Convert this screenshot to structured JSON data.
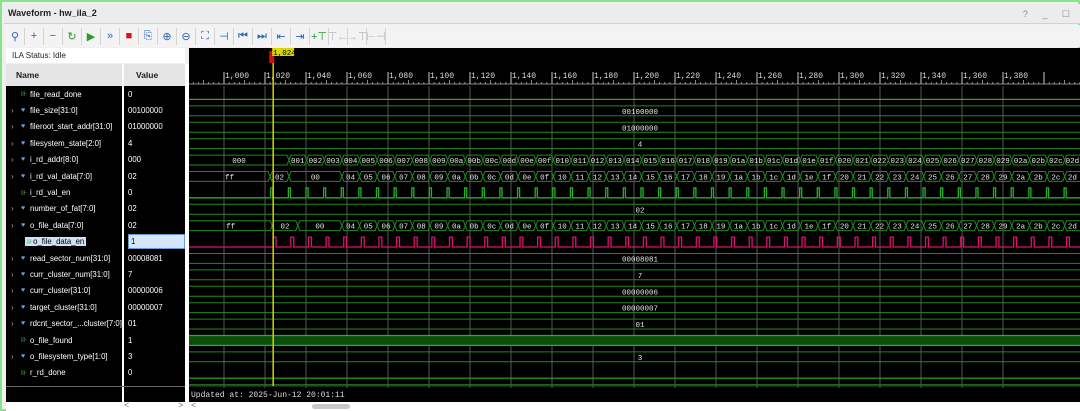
{
  "window": {
    "title": "Waveform - hw_ila_2",
    "controls": "? _ ☐"
  },
  "toolbar": [
    {
      "name": "search",
      "glyph": "⚲"
    },
    {
      "name": "add",
      "glyph": "+"
    },
    {
      "name": "remove",
      "glyph": "−"
    },
    {
      "name": "run-trigger-immediate",
      "glyph": "↻"
    },
    {
      "name": "run-trigger",
      "glyph": "▶"
    },
    {
      "name": "run-continuous",
      "glyph": "»"
    },
    {
      "name": "stop",
      "glyph": "■"
    },
    {
      "name": "export",
      "glyph": "⎘"
    },
    {
      "name": "zoom-in",
      "glyph": "⊕"
    },
    {
      "name": "zoom-out",
      "glyph": "⊖"
    },
    {
      "name": "zoom-fit",
      "glyph": "⛶"
    },
    {
      "name": "goto-cursor",
      "glyph": "⊣"
    },
    {
      "name": "go-to-start",
      "glyph": "⏮"
    },
    {
      "name": "go-to-end",
      "glyph": "⏭"
    },
    {
      "name": "previous-transition",
      "glyph": "⇤"
    },
    {
      "name": "next-transition",
      "glyph": "⇥"
    },
    {
      "name": "add-marker",
      "glyph": "+⊤"
    },
    {
      "name": "previous-marker",
      "glyph": "⊤←",
      "disabled": true
    },
    {
      "name": "next-marker",
      "glyph": "→⊤",
      "disabled": true
    },
    {
      "name": "swap-cursors",
      "glyph": "⊢⊣",
      "disabled": true
    }
  ],
  "status": "ILA Status:  Idle",
  "columns": {
    "name": "Name",
    "value": "Value"
  },
  "colors": {
    "bus": "#1f8a1f",
    "bit": "#23b223",
    "selected": "#e0106e",
    "cursor": "#c8c800",
    "found_fill": "#0b4d0b"
  },
  "timeline": {
    "ticks": [
      "1,000",
      "1,020",
      "1,040",
      "1,060",
      "1,080",
      "1,100",
      "1,120",
      "1,140",
      "1,160",
      "1,180",
      "1,200",
      "1,220",
      "1,240",
      "1,260",
      "1,280",
      "1,300",
      "1,320",
      "1,340",
      "1,360",
      "1,380"
    ],
    "start": 1000,
    "step": 20,
    "cursor": 1024,
    "cursor_label": "1,024"
  },
  "signals": [
    {
      "name": "file_read_done",
      "value": "0",
      "kind": "bit",
      "level": 0
    },
    {
      "name": "file_size[31:0]",
      "value": "00100000",
      "kind": "bus",
      "const": "00100000"
    },
    {
      "name": "fileroot_start_addr[31:0]",
      "value": "01000000",
      "kind": "bus",
      "const": "01000000"
    },
    {
      "name": "filesystem_state[2:0]",
      "value": "4",
      "kind": "bus",
      "const": "4"
    },
    {
      "name": "i_rd_addr[8:0]",
      "value": "000",
      "kind": "bus",
      "pre": [
        {
          "v": "000",
          "until": 1031.7
        }
      ],
      "start": 1031.7,
      "period": 8.6,
      "values": [
        "001",
        "002",
        "003",
        "004",
        "005",
        "006",
        "007",
        "008",
        "009",
        "00a",
        "00b",
        "00c",
        "00d",
        "00e",
        "00f",
        "010",
        "011",
        "012",
        "013",
        "014",
        "015",
        "016",
        "017",
        "018",
        "019",
        "01a",
        "01b",
        "01c",
        "01d",
        "01e",
        "01f",
        "020",
        "021",
        "022",
        "023",
        "024",
        "025",
        "026",
        "027",
        "028",
        "029",
        "02a",
        "02b",
        "02c",
        "02d"
      ]
    },
    {
      "name": "i_rd_val_data[7:0]",
      "value": "02",
      "kind": "bus",
      "pre": [
        {
          "v": "ff",
          "until": 1022.5
        },
        {
          "v": "02",
          "until": 1031.7
        },
        {
          "v": "00",
          "until": 1057.5
        }
      ],
      "start": 1057.5,
      "period": 8.6,
      "values": [
        "04",
        "05",
        "06",
        "07",
        "08",
        "09",
        "0a",
        "0b",
        "0c",
        "0d",
        "0e",
        "0f",
        "10",
        "11",
        "12",
        "13",
        "14",
        "15",
        "16",
        "17",
        "18",
        "19",
        "1a",
        "1b",
        "1c",
        "1d",
        "1e",
        "1f",
        "20",
        "21",
        "22",
        "23",
        "24",
        "25",
        "26",
        "27",
        "28",
        "29",
        "2a",
        "2b",
        "2c",
        "2d"
      ]
    },
    {
      "name": "i_rd_val_en",
      "value": "0",
      "kind": "pulse",
      "first": 1022.8,
      "period": 8.6,
      "width": 1.0
    },
    {
      "name": "number_of_fat[7:0]",
      "value": "02",
      "kind": "bus",
      "const": "02"
    },
    {
      "name": "o_file_data[7:0]",
      "value": "02",
      "kind": "bus",
      "pre": [
        {
          "v": "ff",
          "until": 1023.5
        },
        {
          "v": "02",
          "until": 1036
        },
        {
          "v": "00",
          "until": 1057.5
        }
      ],
      "start": 1057.5,
      "period": 8.6,
      "values": [
        "04",
        "05",
        "06",
        "07",
        "08",
        "09",
        "0a",
        "0b",
        "0c",
        "0d",
        "0e",
        "0f",
        "10",
        "11",
        "12",
        "13",
        "14",
        "15",
        "16",
        "17",
        "18",
        "19",
        "1a",
        "1b",
        "1c",
        "1d",
        "1e",
        "1f",
        "20",
        "21",
        "22",
        "23",
        "24",
        "25",
        "26",
        "27",
        "28",
        "29",
        "2a",
        "2b",
        "2c",
        "2d"
      ]
    },
    {
      "name": "o_file_data_en",
      "value": "1",
      "kind": "pulse",
      "first": 1024,
      "period": 8.6,
      "width": 1.4,
      "selected": true
    },
    {
      "name": "read_sector_num[31:0]",
      "value": "00008081",
      "kind": "bus",
      "const": "00008081"
    },
    {
      "name": "curr_cluster_num[31:0]",
      "value": "7",
      "kind": "bus",
      "const": "7"
    },
    {
      "name": "curr_cluster[31:0]",
      "value": "00000006",
      "kind": "bus",
      "const": "00000006"
    },
    {
      "name": "target_cluster[31:0]",
      "value": "00000007",
      "kind": "bus",
      "const": "00000007"
    },
    {
      "name": "rdcnt_sector_...cluster[7:0]",
      "value": "01",
      "kind": "bus",
      "const": "01"
    },
    {
      "name": "o_file_found",
      "value": "1",
      "kind": "bit",
      "level": 1
    },
    {
      "name": "o_filesystem_type[1:0]",
      "value": "3",
      "kind": "bus",
      "const": "3"
    },
    {
      "name": "r_rd_done",
      "value": "0",
      "kind": "bit",
      "level": 0
    }
  ],
  "footer": {
    "updated": "Updated at: 2025-Jun-12 20:01:11"
  },
  "scroll": {
    "left": "<",
    "right": ">"
  }
}
